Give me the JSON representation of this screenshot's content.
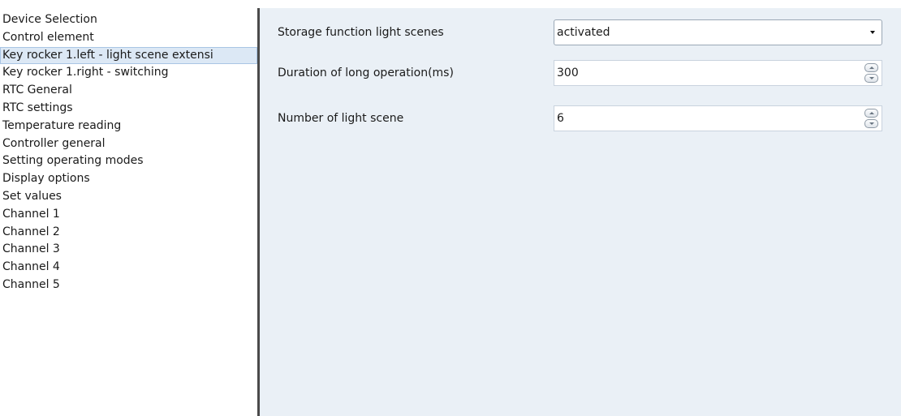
{
  "sidebar": {
    "selected_index": 2,
    "items": [
      {
        "label": "Device Selection"
      },
      {
        "label": "Control element"
      },
      {
        "label": "Key rocker 1.left - light scene extensi"
      },
      {
        "label": "Key rocker 1.right - switching"
      },
      {
        "label": "RTC General"
      },
      {
        "label": "RTC settings"
      },
      {
        "label": "Temperature reading"
      },
      {
        "label": "Controller general"
      },
      {
        "label": "Setting operating modes"
      },
      {
        "label": "Display options"
      },
      {
        "label": "Set values"
      },
      {
        "label": "Channel 1"
      },
      {
        "label": "Channel 2"
      },
      {
        "label": "Channel 3"
      },
      {
        "label": "Channel 4"
      },
      {
        "label": "Channel 5"
      }
    ]
  },
  "params": {
    "storage_function": {
      "label": "Storage function light scenes",
      "value": "activated",
      "icon": "chevron-down-icon"
    },
    "long_operation": {
      "label": "Duration of long operation(ms)",
      "value": "300",
      "icons": [
        "spin-up-icon",
        "spin-down-icon"
      ]
    },
    "light_scene_count": {
      "label": "Number of light scene",
      "value": "6",
      "icons": [
        "spin-up-icon",
        "spin-down-icon"
      ]
    }
  },
  "colors": {
    "content_background": "#eaf0f6",
    "sidebar_background": "#ffffff",
    "selected_item": "#dce8f5",
    "divider": "#4a4a4a"
  }
}
